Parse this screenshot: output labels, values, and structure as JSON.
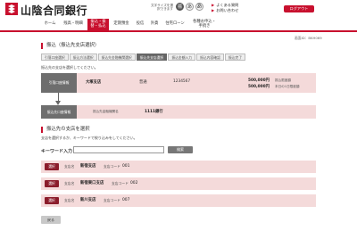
{
  "header": {
    "bank_name": "山陰合同銀行",
    "font_size_label": "文字サイズを選択できます",
    "font_sizes": [
      "標",
      "あ",
      "あ"
    ],
    "help_links": [
      "よくある質問",
      "お問い合わせ"
    ],
    "logout_label": "ログアウト"
  },
  "nav": {
    "items": [
      "ホーム",
      "残高・明細",
      "振込・振替・払込",
      "定期預金",
      "投信",
      "外貨",
      "住宅ローン",
      "各種お申込・手続き"
    ]
  },
  "screen_id": "画面ID：BKH069",
  "page_title": "振込（振込先支店選択）",
  "steps": [
    "引落口座選択",
    "振込方法選択",
    "振込先金融機関選択",
    "振込先支店選択",
    "振込金額入力",
    "振込内容確認",
    "振込完了"
  ],
  "current_step_index": 3,
  "note": "振込先の支店を選択してください。",
  "from_account": {
    "tag": "引落口座情報",
    "branch": "大塚支店",
    "type": "普通",
    "number": "1234567",
    "amount_1": "500,000円",
    "amount_1_label": "振込限度額",
    "amount_2": "500,000円",
    "amount_2_label": "本日の1日限度額"
  },
  "to_account": {
    "tag": "振込先口座情報",
    "bank_label": "振込先金融機関名",
    "bank_name": "1111銀行"
  },
  "branch_section": {
    "title": "振込先の支店を選択",
    "guide": "支店を選択するか、キーワードで絞り込みをしてください。",
    "keyword_label": "キーワード入力",
    "keyword_value": "",
    "search_label": "検索",
    "select_label": "選択",
    "branch_name_label": "支店名",
    "branch_code_label": "支店コード",
    "branches": [
      {
        "name": "新宿支店",
        "code": "001"
      },
      {
        "name": "新宿東口支店",
        "code": "002"
      },
      {
        "name": "新川支店",
        "code": "007"
      }
    ]
  },
  "back_label": "戻る",
  "colors": {
    "brand": "#c8102e",
    "panel": "#f4dada",
    "select_button": "#8b1c2b"
  }
}
